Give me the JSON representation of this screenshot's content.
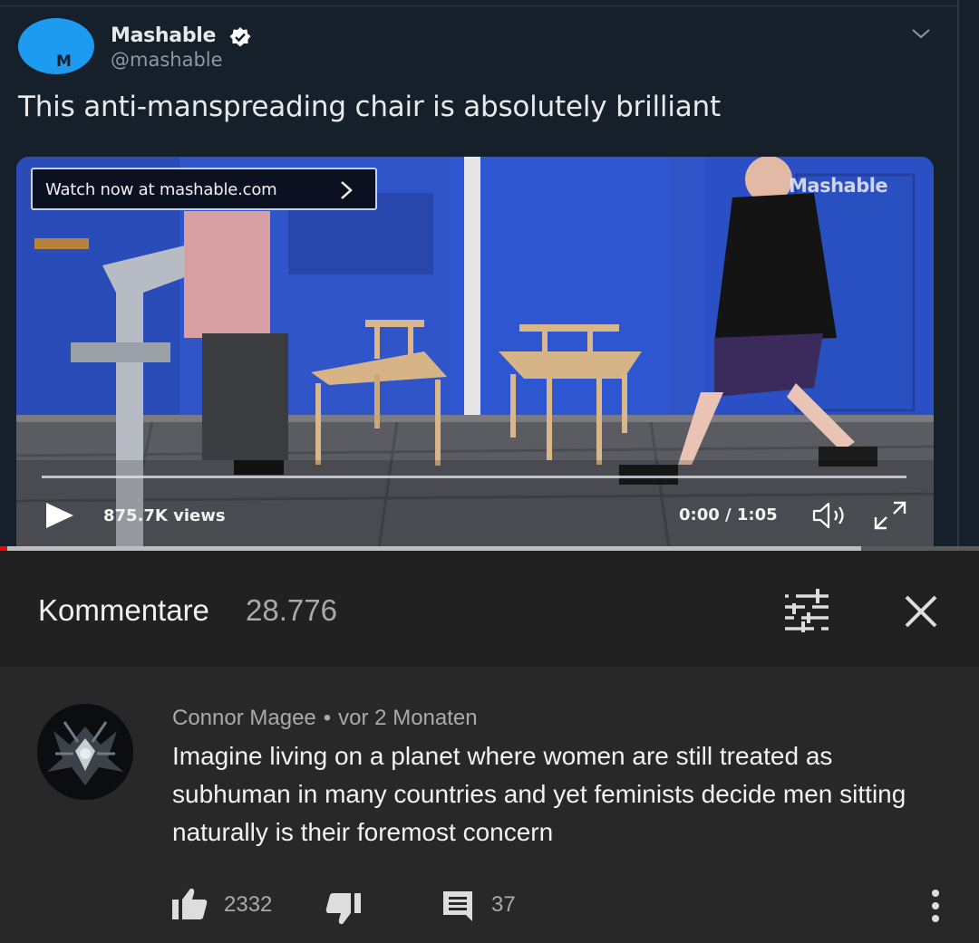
{
  "video": {
    "tweet": {
      "avatar_letter": "M",
      "author_name": "Mashable",
      "handle": "@mashable",
      "text": "This anti-manspreading chair is absolutely brilliant"
    },
    "player": {
      "banner_label": "Watch now at mashable.com",
      "watermark": "Mashable",
      "views": "875.7K views",
      "time": "0:00 / 1:05"
    },
    "progress": {
      "buffered_fraction": 0.88,
      "played_fraction": 0.007
    }
  },
  "comments": {
    "title": "Kommentare",
    "count": "28.776"
  },
  "comment": {
    "author": "Connor Magee",
    "separator": "•",
    "age": "vor 2 Monaten",
    "text": "Imagine living on a planet where women are still treated as subhuman in many countries and yet feminists decide men sitting naturally is their foremost concern",
    "likes": "2332",
    "replies": "37"
  },
  "colors": {
    "tweet_bg": "#15202b",
    "brand_blue": "#1d9bf0",
    "panel_bg": "#212121",
    "comment_bg": "#282828",
    "progress_red": "#ff0000"
  },
  "icons": [
    "verified-icon",
    "chevron-down-icon",
    "play-icon",
    "volume-icon",
    "fullscreen-icon",
    "sort-icon",
    "close-icon",
    "thumbs-up-icon",
    "thumbs-down-icon",
    "reply-icon",
    "more-vert-icon"
  ]
}
